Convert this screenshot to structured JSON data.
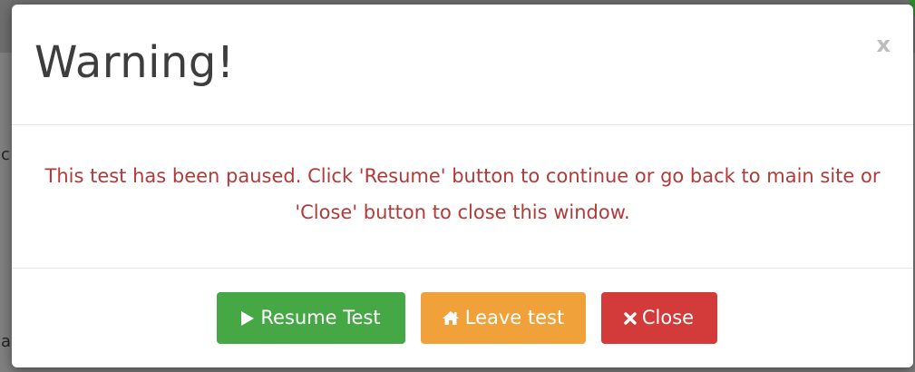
{
  "page_background": {
    "left_chars": [
      "c",
      "a"
    ]
  },
  "modal": {
    "title": "Warning!",
    "close_glyph": "x",
    "message": "This test has been paused. Click 'Resume' button to continue or go back to main site or 'Close' button to close this window.",
    "message_color": "#b23a3a",
    "buttons": {
      "resume": {
        "label": "Resume Test",
        "icon": "play-icon",
        "color": "#45a845"
      },
      "leave": {
        "label": "Leave test",
        "icon": "home-icon",
        "color": "#f0a13a"
      },
      "close": {
        "label": "Close",
        "icon": "times-icon",
        "color": "#d23b39"
      }
    }
  }
}
